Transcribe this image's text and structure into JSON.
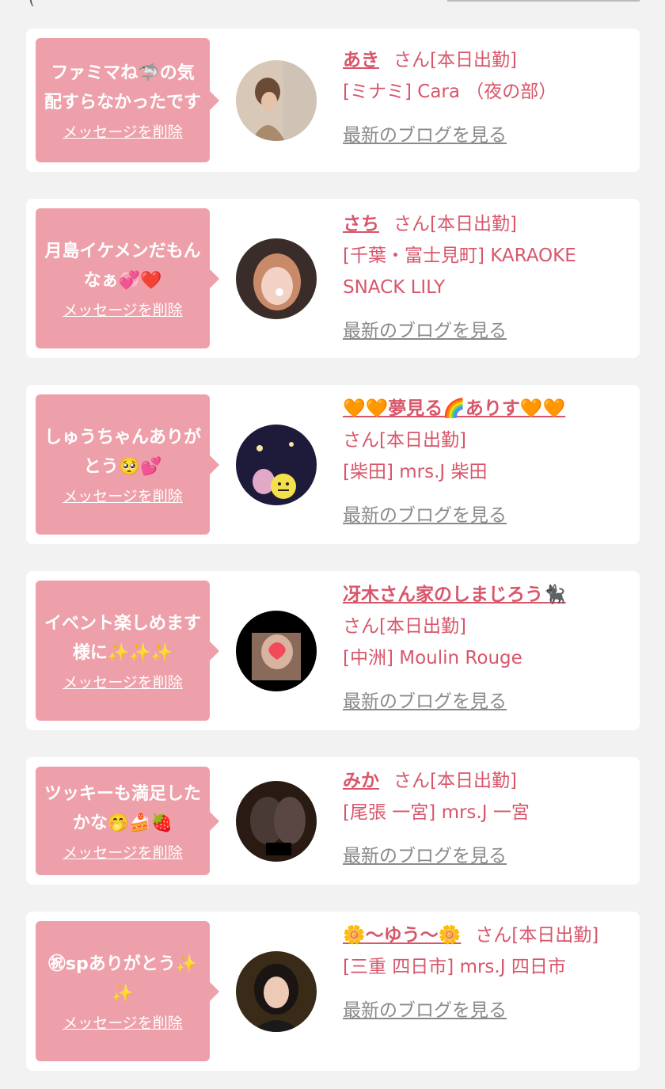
{
  "top": {
    "paren": "("
  },
  "colors": {
    "bubble": "#eea0aa",
    "accent": "#d8566a",
    "link_gray": "#8a8a8a",
    "background": "#f2f2f2"
  },
  "delete_label": "メッセージを削除",
  "blog_label": "最新のブログを見る",
  "suffix": "さん[本日出勤]",
  "cards": [
    {
      "message": "ファミマね🦈の気配すらなかったです",
      "name": "あき",
      "shop": "[ミナミ] Cara （夜の部）"
    },
    {
      "message": "月島イケメンだもんなぁ💞❤️",
      "name": "さち",
      "shop": "[千葉・富士見町] KARAOKE SNACK LILY"
    },
    {
      "message": "しゅうちゃんありがとう🥺💕",
      "name": "🧡🧡夢見る🌈ありす🧡🧡",
      "shop": "[柴田] mrs.J 柴田"
    },
    {
      "message": "イベント楽しめます様に✨✨✨",
      "name": "冴木さん家のしまじろう🐈‍⬛",
      "shop": "[中洲] Moulin Rouge"
    },
    {
      "message": "ツッキーも満足したかな🤭🍰🍓",
      "name": "みか",
      "shop": "[尾張 一宮] mrs.J 一宮"
    },
    {
      "message": "㊗spありがとう✨✨",
      "name": "🌼〜ゆう〜🌼",
      "shop": "[三重 四日市] mrs.J 四日市"
    }
  ]
}
